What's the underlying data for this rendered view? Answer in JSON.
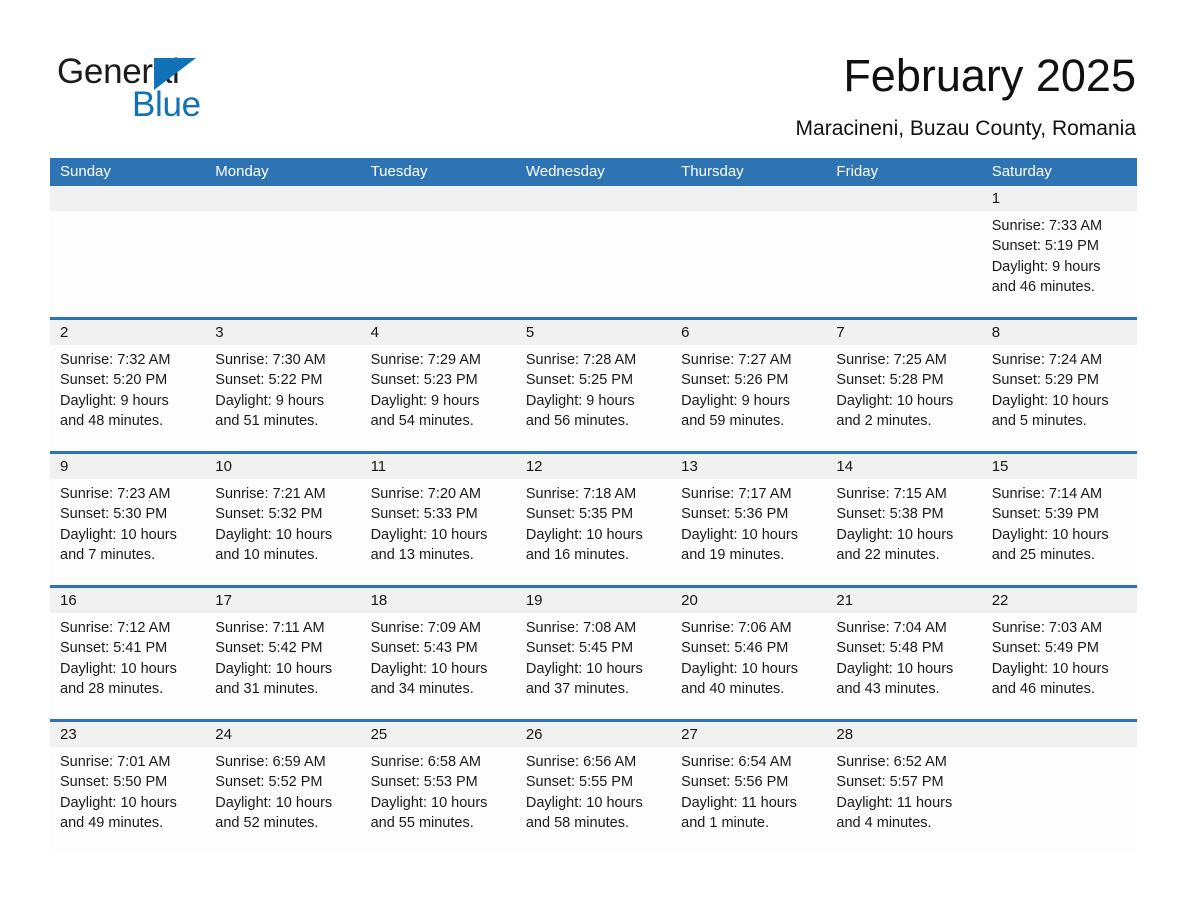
{
  "brand": {
    "name_part1": "General",
    "name_part2": "Blue",
    "accent_color": "#1272b8"
  },
  "header": {
    "title": "February 2025",
    "location": "Maracineni, Buzau County, Romania"
  },
  "theme": {
    "header_blue": "#2e74b5",
    "daynum_band": "#f1f1f1",
    "cell_background": "#fdfdfd"
  },
  "weekdays": [
    "Sunday",
    "Monday",
    "Tuesday",
    "Wednesday",
    "Thursday",
    "Friday",
    "Saturday"
  ],
  "weeks": [
    [
      {
        "day": ""
      },
      {
        "day": ""
      },
      {
        "day": ""
      },
      {
        "day": ""
      },
      {
        "day": ""
      },
      {
        "day": ""
      },
      {
        "day": "1",
        "sunrise": "Sunrise: 7:33 AM",
        "sunset": "Sunset: 5:19 PM",
        "daylight1": "Daylight: 9 hours",
        "daylight2": "and 46 minutes."
      }
    ],
    [
      {
        "day": "2",
        "sunrise": "Sunrise: 7:32 AM",
        "sunset": "Sunset: 5:20 PM",
        "daylight1": "Daylight: 9 hours",
        "daylight2": "and 48 minutes."
      },
      {
        "day": "3",
        "sunrise": "Sunrise: 7:30 AM",
        "sunset": "Sunset: 5:22 PM",
        "daylight1": "Daylight: 9 hours",
        "daylight2": "and 51 minutes."
      },
      {
        "day": "4",
        "sunrise": "Sunrise: 7:29 AM",
        "sunset": "Sunset: 5:23 PM",
        "daylight1": "Daylight: 9 hours",
        "daylight2": "and 54 minutes."
      },
      {
        "day": "5",
        "sunrise": "Sunrise: 7:28 AM",
        "sunset": "Sunset: 5:25 PM",
        "daylight1": "Daylight: 9 hours",
        "daylight2": "and 56 minutes."
      },
      {
        "day": "6",
        "sunrise": "Sunrise: 7:27 AM",
        "sunset": "Sunset: 5:26 PM",
        "daylight1": "Daylight: 9 hours",
        "daylight2": "and 59 minutes."
      },
      {
        "day": "7",
        "sunrise": "Sunrise: 7:25 AM",
        "sunset": "Sunset: 5:28 PM",
        "daylight1": "Daylight: 10 hours",
        "daylight2": "and 2 minutes."
      },
      {
        "day": "8",
        "sunrise": "Sunrise: 7:24 AM",
        "sunset": "Sunset: 5:29 PM",
        "daylight1": "Daylight: 10 hours",
        "daylight2": "and 5 minutes."
      }
    ],
    [
      {
        "day": "9",
        "sunrise": "Sunrise: 7:23 AM",
        "sunset": "Sunset: 5:30 PM",
        "daylight1": "Daylight: 10 hours",
        "daylight2": "and 7 minutes."
      },
      {
        "day": "10",
        "sunrise": "Sunrise: 7:21 AM",
        "sunset": "Sunset: 5:32 PM",
        "daylight1": "Daylight: 10 hours",
        "daylight2": "and 10 minutes."
      },
      {
        "day": "11",
        "sunrise": "Sunrise: 7:20 AM",
        "sunset": "Sunset: 5:33 PM",
        "daylight1": "Daylight: 10 hours",
        "daylight2": "and 13 minutes."
      },
      {
        "day": "12",
        "sunrise": "Sunrise: 7:18 AM",
        "sunset": "Sunset: 5:35 PM",
        "daylight1": "Daylight: 10 hours",
        "daylight2": "and 16 minutes."
      },
      {
        "day": "13",
        "sunrise": "Sunrise: 7:17 AM",
        "sunset": "Sunset: 5:36 PM",
        "daylight1": "Daylight: 10 hours",
        "daylight2": "and 19 minutes."
      },
      {
        "day": "14",
        "sunrise": "Sunrise: 7:15 AM",
        "sunset": "Sunset: 5:38 PM",
        "daylight1": "Daylight: 10 hours",
        "daylight2": "and 22 minutes."
      },
      {
        "day": "15",
        "sunrise": "Sunrise: 7:14 AM",
        "sunset": "Sunset: 5:39 PM",
        "daylight1": "Daylight: 10 hours",
        "daylight2": "and 25 minutes."
      }
    ],
    [
      {
        "day": "16",
        "sunrise": "Sunrise: 7:12 AM",
        "sunset": "Sunset: 5:41 PM",
        "daylight1": "Daylight: 10 hours",
        "daylight2": "and 28 minutes."
      },
      {
        "day": "17",
        "sunrise": "Sunrise: 7:11 AM",
        "sunset": "Sunset: 5:42 PM",
        "daylight1": "Daylight: 10 hours",
        "daylight2": "and 31 minutes."
      },
      {
        "day": "18",
        "sunrise": "Sunrise: 7:09 AM",
        "sunset": "Sunset: 5:43 PM",
        "daylight1": "Daylight: 10 hours",
        "daylight2": "and 34 minutes."
      },
      {
        "day": "19",
        "sunrise": "Sunrise: 7:08 AM",
        "sunset": "Sunset: 5:45 PM",
        "daylight1": "Daylight: 10 hours",
        "daylight2": "and 37 minutes."
      },
      {
        "day": "20",
        "sunrise": "Sunrise: 7:06 AM",
        "sunset": "Sunset: 5:46 PM",
        "daylight1": "Daylight: 10 hours",
        "daylight2": "and 40 minutes."
      },
      {
        "day": "21",
        "sunrise": "Sunrise: 7:04 AM",
        "sunset": "Sunset: 5:48 PM",
        "daylight1": "Daylight: 10 hours",
        "daylight2": "and 43 minutes."
      },
      {
        "day": "22",
        "sunrise": "Sunrise: 7:03 AM",
        "sunset": "Sunset: 5:49 PM",
        "daylight1": "Daylight: 10 hours",
        "daylight2": "and 46 minutes."
      }
    ],
    [
      {
        "day": "23",
        "sunrise": "Sunrise: 7:01 AM",
        "sunset": "Sunset: 5:50 PM",
        "daylight1": "Daylight: 10 hours",
        "daylight2": "and 49 minutes."
      },
      {
        "day": "24",
        "sunrise": "Sunrise: 6:59 AM",
        "sunset": "Sunset: 5:52 PM",
        "daylight1": "Daylight: 10 hours",
        "daylight2": "and 52 minutes."
      },
      {
        "day": "25",
        "sunrise": "Sunrise: 6:58 AM",
        "sunset": "Sunset: 5:53 PM",
        "daylight1": "Daylight: 10 hours",
        "daylight2": "and 55 minutes."
      },
      {
        "day": "26",
        "sunrise": "Sunrise: 6:56 AM",
        "sunset": "Sunset: 5:55 PM",
        "daylight1": "Daylight: 10 hours",
        "daylight2": "and 58 minutes."
      },
      {
        "day": "27",
        "sunrise": "Sunrise: 6:54 AM",
        "sunset": "Sunset: 5:56 PM",
        "daylight1": "Daylight: 11 hours",
        "daylight2": "and 1 minute."
      },
      {
        "day": "28",
        "sunrise": "Sunrise: 6:52 AM",
        "sunset": "Sunset: 5:57 PM",
        "daylight1": "Daylight: 11 hours",
        "daylight2": "and 4 minutes."
      },
      {
        "day": ""
      }
    ]
  ]
}
